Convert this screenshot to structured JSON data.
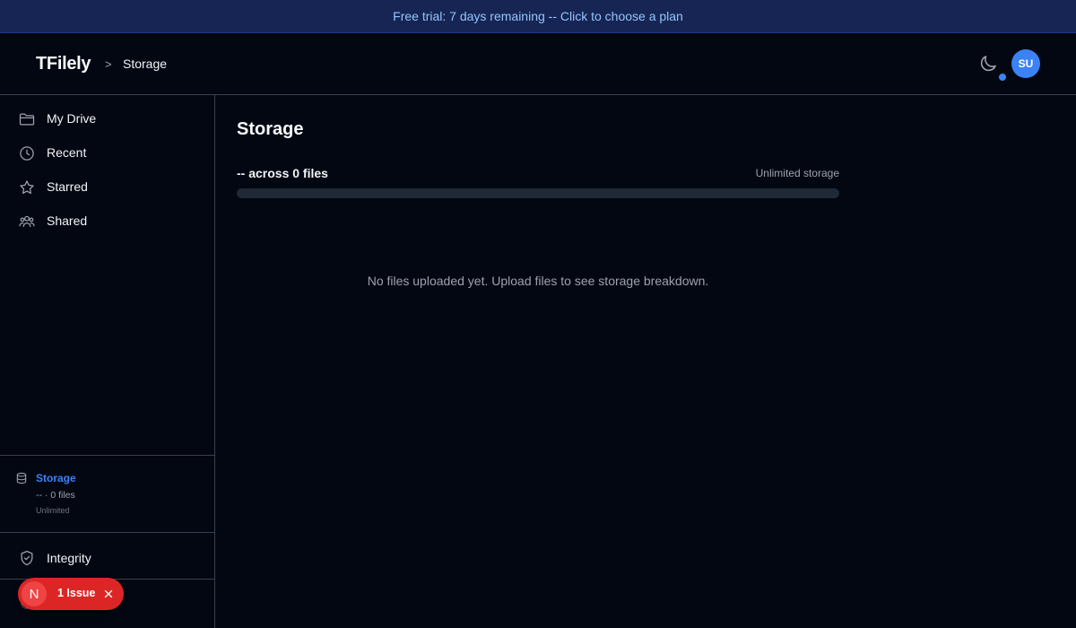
{
  "banner": {
    "text": "Free trial: 7 days remaining -- Click to choose a plan"
  },
  "header": {
    "brand": "TFilely",
    "separator": ">",
    "breadcrumb": "Storage",
    "avatar_initials": "SU",
    "theme_icon": "moon-icon"
  },
  "sidebar": {
    "items": [
      {
        "label": "My Drive",
        "icon": "folder-icon"
      },
      {
        "label": "Recent",
        "icon": "clock-icon"
      },
      {
        "label": "Starred",
        "icon": "star-icon"
      },
      {
        "label": "Shared",
        "icon": "users-icon"
      }
    ],
    "storage": {
      "title": "Storage",
      "summary": "-- · 0 files",
      "limit": "Unlimited",
      "icon": "database-icon"
    },
    "integrity": {
      "label": "Integrity",
      "icon": "shield-check-icon"
    }
  },
  "main": {
    "title": "Storage",
    "usage_text": "-- across 0 files",
    "limit_text": "Unlimited storage",
    "progress": 0,
    "empty_message": "No files uploaded yet. Upload files to see storage breakdown."
  },
  "issue_badge": {
    "letter": "N",
    "label": "1 Issue",
    "color": "#dc2626"
  },
  "colors": {
    "accent": "#3b82f6",
    "background": "#030712",
    "banner": "#172554"
  }
}
